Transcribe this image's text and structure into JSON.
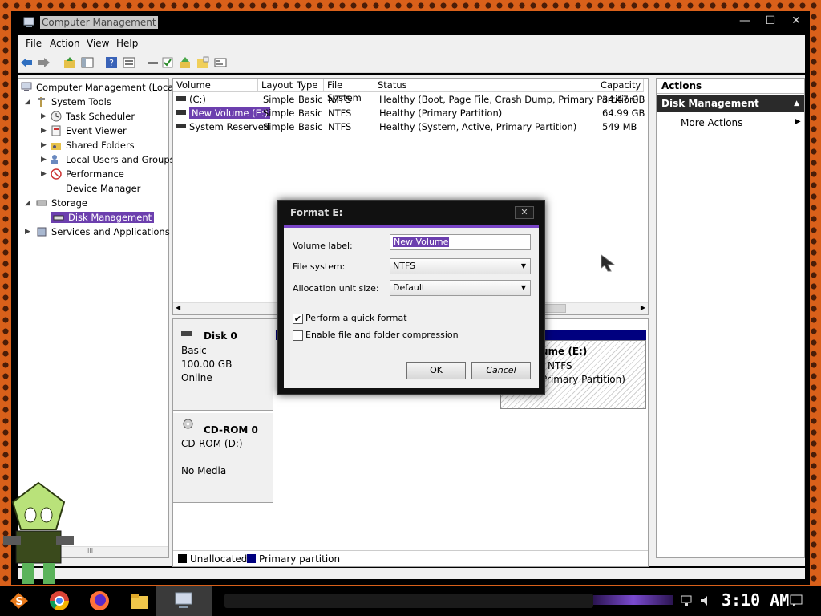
{
  "window": {
    "title": "Computer Management",
    "controls": {
      "minimize": "—",
      "maximize": "☐",
      "close": "✕"
    }
  },
  "menu": [
    "File",
    "Action",
    "View",
    "Help"
  ],
  "toolbar_icons": [
    "back-arrow-icon",
    "forward-arrow-icon",
    "up-folder-icon",
    "console-tree-icon",
    "help-icon",
    "properties-icon",
    "connect-icon",
    "check-icon",
    "export-icon",
    "open-folder-icon",
    "view-icon"
  ],
  "tree": {
    "root": "Computer Management (Local)",
    "system_tools": "System Tools",
    "task_scheduler": "Task Scheduler",
    "event_viewer": "Event Viewer",
    "shared_folders": "Shared Folders",
    "local_users": "Local Users and Groups",
    "performance": "Performance",
    "device_manager": "Device Manager",
    "storage": "Storage",
    "disk_management": "Disk Management",
    "services": "Services and Applications",
    "scroll_grip": "III"
  },
  "volumes": {
    "columns": [
      "Volume",
      "Layout",
      "Type",
      "File System",
      "Status",
      "Capacity"
    ],
    "rows": [
      {
        "volume": "(C:)",
        "layout": "Simple",
        "type": "Basic",
        "fs": "NTFS",
        "status": "Healthy (Boot, Page File, Crash Dump, Primary Partition)",
        "capacity": "34.47 GB"
      },
      {
        "volume": "New Volume (E:)",
        "layout": "Simple",
        "type": "Basic",
        "fs": "NTFS",
        "status": "Healthy (Primary Partition)",
        "capacity": "64.99 GB"
      },
      {
        "volume": "System Reserved",
        "layout": "Simple",
        "type": "Basic",
        "fs": "NTFS",
        "status": "Healthy (System, Active, Primary Partition)",
        "capacity": "549 MB"
      }
    ]
  },
  "disks": {
    "disk0": {
      "name": "Disk 0",
      "type": "Basic",
      "size": "100.00 GB",
      "state": "Online",
      "partition_e": {
        "name": "ume  (E:)",
        "fs": "NTFS",
        "status": "Primary Partition)"
      }
    },
    "cdrom": {
      "name": "CD-ROM 0",
      "drive": "CD-ROM (D:)",
      "media": "No Media"
    }
  },
  "legend": {
    "unallocated": "Unallocated",
    "primary": "Primary partition",
    "unallocated_color": "#000000",
    "primary_color": "#00007f"
  },
  "actions": {
    "header": "Actions",
    "section": "Disk Management",
    "more": "More Actions"
  },
  "dialog": {
    "title": "Format E:",
    "close": "✕",
    "volume_label_label": "Volume label:",
    "volume_label_value": "New Volume",
    "file_system_label": "File system:",
    "file_system_value": "NTFS",
    "allocation_label": "Allocation unit size:",
    "allocation_value": "Default",
    "quick_format": "Perform a quick format",
    "quick_format_checked": true,
    "compression": "Enable file and folder compression",
    "compression_checked": false,
    "ok": "OK",
    "cancel": "Cancel"
  },
  "taskbar": {
    "clock": "3:10 AM",
    "apps": [
      "start-icon",
      "chrome-icon",
      "firefox-icon",
      "file-explorer-icon",
      "computer-management-icon"
    ]
  },
  "colors": {
    "accent": "#6c3fae",
    "selection": "#6c3fae",
    "dialog_frame": "#111111"
  }
}
